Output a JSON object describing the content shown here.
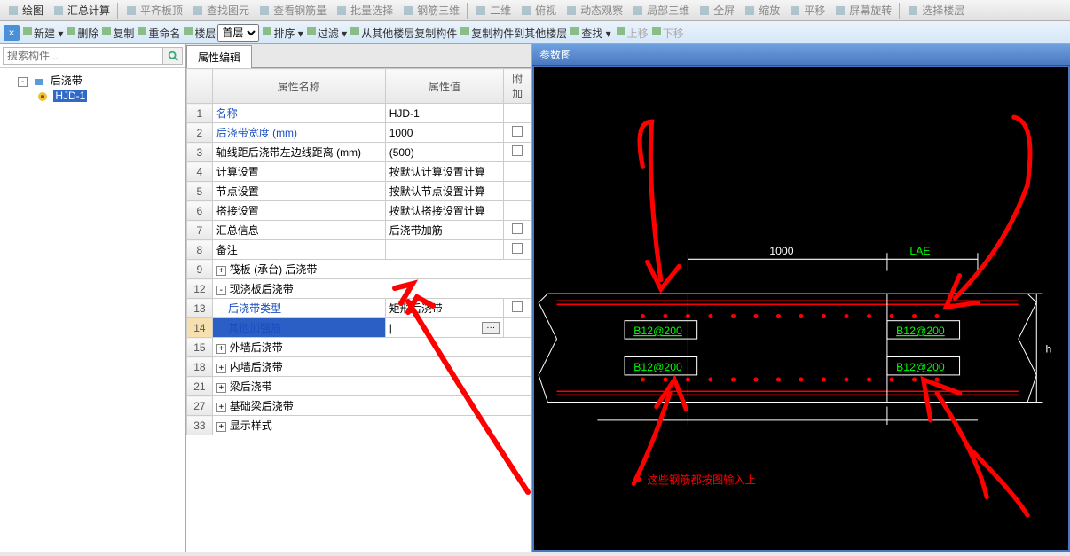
{
  "toolbars": {
    "top": [
      {
        "n": "draw-icon",
        "label": "绘图",
        "active": true
      },
      {
        "n": "sum-icon",
        "label": "汇总计算",
        "active": true
      },
      {
        "sep": true
      },
      {
        "n": "flat-top-icon",
        "label": "平齐板顶"
      },
      {
        "n": "find-yuan-icon",
        "label": "查找图元"
      },
      {
        "n": "view-rebar-icon",
        "label": "查看钢筋量"
      },
      {
        "n": "batch-sel-icon",
        "label": "批量选择"
      },
      {
        "n": "rebar-3d-icon",
        "label": "钢筋三维"
      },
      {
        "sep": true
      },
      {
        "n": "2d-icon",
        "label": "二维"
      },
      {
        "n": "topview-icon",
        "label": "俯视"
      },
      {
        "n": "dyn-obs-icon",
        "label": "动态观察"
      },
      {
        "n": "local-3d-icon",
        "label": "局部三维"
      },
      {
        "n": "fullscreen-icon",
        "label": "全屏"
      },
      {
        "n": "zoom-icon",
        "label": "缩放"
      },
      {
        "n": "pan-icon",
        "label": "平移"
      },
      {
        "n": "scr-rot-icon",
        "label": "屏幕旋转"
      },
      {
        "sep": true
      },
      {
        "n": "sel-floor-icon",
        "label": "选择楼层"
      }
    ],
    "second": {
      "close_x": "×",
      "items": [
        {
          "n": "new-icon",
          "label": "新建",
          "dd": true
        },
        {
          "n": "del-icon",
          "label": "删除"
        },
        {
          "n": "copy-icon",
          "label": "复制"
        },
        {
          "n": "rename-icon",
          "label": "重命名"
        },
        {
          "n": "floor-label",
          "label": "楼层"
        },
        {
          "select": "首层"
        },
        {
          "n": "sort-icon",
          "label": "排序",
          "dd": true
        },
        {
          "n": "filter-icon",
          "label": "过滤",
          "dd": true
        },
        {
          "n": "copy-from-icon",
          "label": "从其他楼层复制构件"
        },
        {
          "n": "copy-to-icon",
          "label": "复制构件到其他楼层"
        },
        {
          "n": "find-icon",
          "label": "查找",
          "dd": true
        },
        {
          "sep": true
        },
        {
          "n": "move-up-icon",
          "label": "上移",
          "dim": true
        },
        {
          "n": "move-down-icon",
          "label": "下移",
          "dim": true
        }
      ]
    }
  },
  "left": {
    "search_ph": "搜索构件...",
    "tree_root": "后浇带",
    "tree_child": "HJD-1"
  },
  "mid": {
    "tab": "属性编辑",
    "headers": {
      "name": "属性名称",
      "value": "属性值",
      "att": "附加"
    },
    "rows": [
      {
        "num": "1",
        "name": "名称",
        "val": "HJD-1",
        "link": true
      },
      {
        "num": "2",
        "name": "后浇带宽度 (mm)",
        "val": "1000",
        "link": true,
        "chk": true
      },
      {
        "num": "3",
        "name": "轴线距后浇带左边线距离 (mm)",
        "val": "(500)",
        "chk": true
      },
      {
        "num": "4",
        "name": "计算设置",
        "val": "按默认计算设置计算"
      },
      {
        "num": "5",
        "name": "节点设置",
        "val": "按默认节点设置计算"
      },
      {
        "num": "6",
        "name": "搭接设置",
        "val": "按默认搭接设置计算"
      },
      {
        "num": "7",
        "name": "汇总信息",
        "val": "后浇带加筋",
        "chk": true
      },
      {
        "num": "8",
        "name": "备注",
        "val": "",
        "chk": true
      },
      {
        "num": "9",
        "name": "筏板 (承台) 后浇带",
        "exp": "+",
        "group": true
      },
      {
        "num": "12",
        "name": "现浇板后浇带",
        "exp": "-",
        "group": true
      },
      {
        "num": "13",
        "name": "后浇带类型",
        "val": "矩形后浇带",
        "link": true,
        "indent": 1,
        "chk": true
      },
      {
        "num": "14",
        "name": "其他加强筋",
        "val": "",
        "link": true,
        "indent": 1,
        "sel": true,
        "ell": true
      },
      {
        "num": "15",
        "name": "外墙后浇带",
        "exp": "+",
        "group": true
      },
      {
        "num": "18",
        "name": "内墙后浇带",
        "exp": "+",
        "group": true
      },
      {
        "num": "21",
        "name": "梁后浇带",
        "exp": "+",
        "group": true
      },
      {
        "num": "27",
        "name": "基础梁后浇带",
        "exp": "+",
        "group": true
      },
      {
        "num": "33",
        "name": "显示样式",
        "exp": "+",
        "group": true
      }
    ]
  },
  "right": {
    "title": "参数图",
    "dim_1000": "1000",
    "dim_lae": "LAE",
    "dim_h": "h",
    "rebar_label": "B12@200",
    "annot_text": "这些钢筋都按图输入上"
  }
}
